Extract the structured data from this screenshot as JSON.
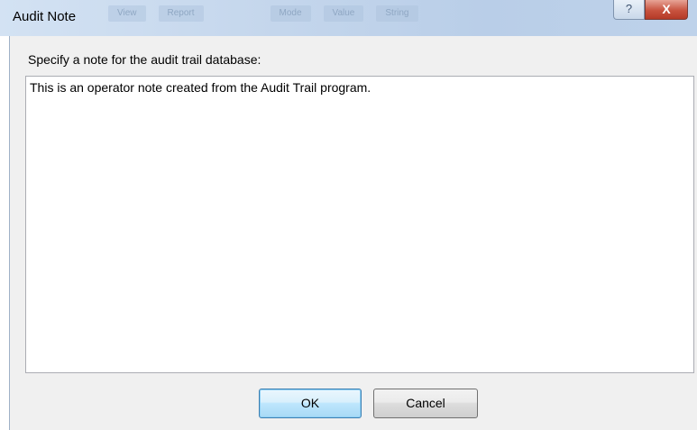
{
  "window": {
    "title": "Audit Note",
    "background_tabs": [
      "View",
      "Report",
      "Mode",
      "Value",
      "String"
    ],
    "help_label": "?",
    "close_label": "X"
  },
  "form": {
    "prompt_label": "Specify a note for the audit trail database:",
    "note_value": "This is an operator note created from the Audit Trail program."
  },
  "buttons": {
    "ok_label": "OK",
    "cancel_label": "Cancel"
  },
  "colors": {
    "titlebar": "#c4d6ec",
    "client_background": "#f0f0f0",
    "close_button": "#c8533f",
    "default_button_border": "#3c7fb1"
  }
}
